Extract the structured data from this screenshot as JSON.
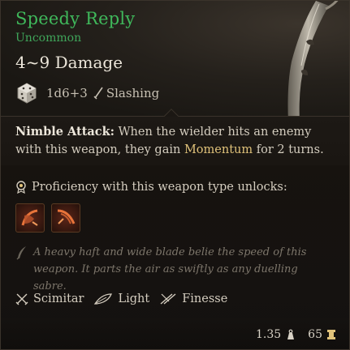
{
  "item": {
    "name": "Speedy Reply",
    "rarity": "Uncommon",
    "damage": "4~9 Damage",
    "dice": "1d6+3",
    "damage_type": "Slashing"
  },
  "passive": {
    "keyword": "Nimble Attack:",
    "text_before": " When the wielder hits an enemy with this weapon, they gain ",
    "highlight": "Momentum",
    "text_after": " for 2 turns."
  },
  "proficiency": {
    "label": "Proficiency with this weapon type unlocks:",
    "abilities": [
      "ability-slash-icon",
      "ability-lacerate-icon"
    ]
  },
  "lore": "A heavy haft and wide blade belie the speed of this weapon. It parts the air as swiftly as any duelling sabre.",
  "properties": [
    {
      "label": "Scimitar",
      "icon": "crossed-blades-icon"
    },
    {
      "label": "Light",
      "icon": "feather-icon"
    },
    {
      "label": "Finesse",
      "icon": "finesse-icon"
    }
  ],
  "footer": {
    "weight": "1.35",
    "value": "65"
  },
  "colors": {
    "name": "#3fb85b",
    "highlight": "#e0c27a",
    "lore": "#7d766b"
  }
}
